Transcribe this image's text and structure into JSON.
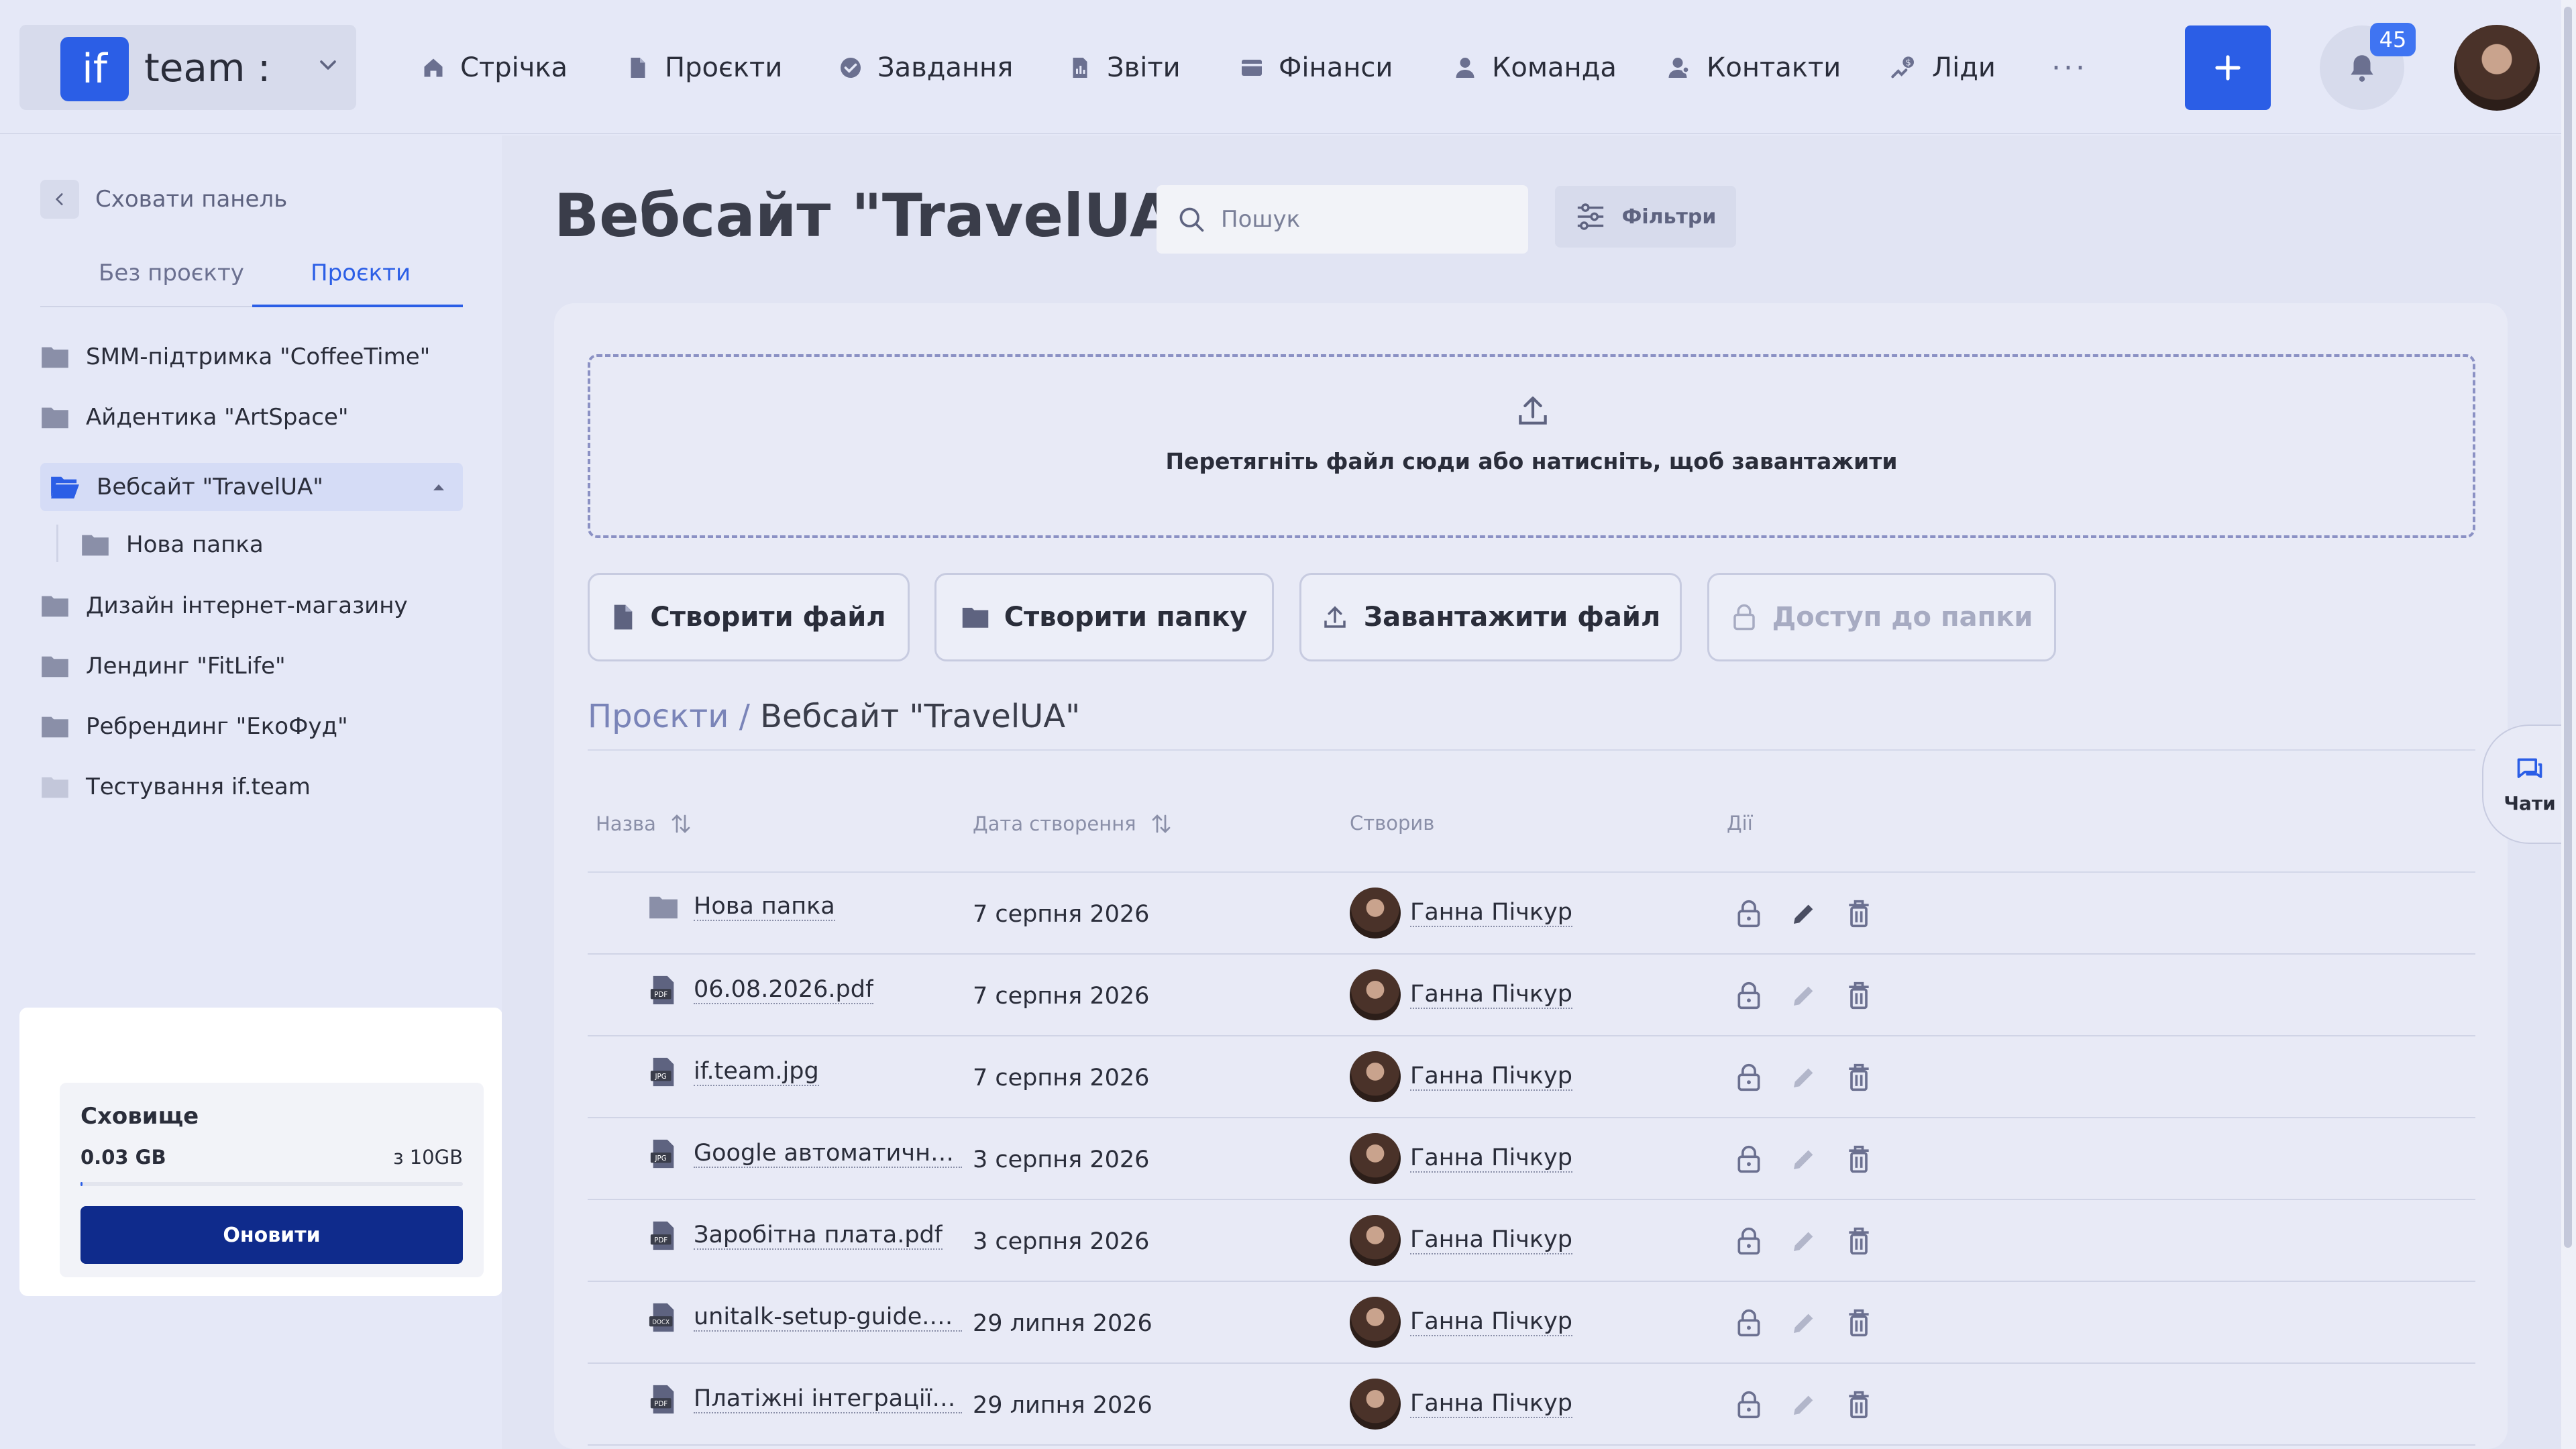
{
  "app": {
    "logo_text": "if",
    "team_name": "team :",
    "notifications_count": "45"
  },
  "nav": {
    "items": [
      {
        "label": "Стрічка",
        "icon": "home-icon"
      },
      {
        "label": "Проєкти",
        "icon": "document-icon"
      },
      {
        "label": "Завдання",
        "icon": "check-circle-icon"
      },
      {
        "label": "Звіти",
        "icon": "report-icon"
      },
      {
        "label": "Фінанси",
        "icon": "wallet-icon"
      },
      {
        "label": "Команда",
        "icon": "user-icon"
      },
      {
        "label": "Контакти",
        "icon": "contacts-icon"
      },
      {
        "label": "Ліди",
        "icon": "leads-icon"
      }
    ],
    "more_label": "···"
  },
  "sidebar": {
    "hide_label": "Сховати панель",
    "tabs": [
      {
        "label": "Без проєкту",
        "active": false
      },
      {
        "label": "Проєкти",
        "active": true
      }
    ],
    "projects": [
      {
        "label": "SMM-підтримка \"CoffeeTime\""
      },
      {
        "label": "Айдентика \"ArtSpace\""
      },
      {
        "label": "Вебсайт \"TravelUA\"",
        "active": true
      },
      {
        "label": "Нова папка",
        "sub": true
      },
      {
        "label": "Дизайн інтернет-магазину"
      },
      {
        "label": "Лендинг \"FitLife\""
      },
      {
        "label": "Ребрендинг \"ЕкоФуд\""
      },
      {
        "label": "Тестування if.team"
      }
    ]
  },
  "storage": {
    "title": "Сховище",
    "used": "0.03 GB",
    "total": "з 10GB",
    "fraction_used": 0.003,
    "button_label": "Оновити"
  },
  "main": {
    "title": "Вебсайт \"TravelUA\"",
    "search_placeholder": "Пошук",
    "filters_label": "Фільтри",
    "dropzone_text": "Перетягніть файл сюди або натисніть, щоб завантажити",
    "actions": [
      {
        "label": "Створити файл",
        "icon": "file-icon",
        "disabled": false
      },
      {
        "label": "Створити папку",
        "icon": "folder-icon",
        "disabled": false
      },
      {
        "label": "Завантажити файл",
        "icon": "upload-icon",
        "disabled": false
      },
      {
        "label": "Доступ до папки",
        "icon": "lock-icon",
        "disabled": true
      }
    ],
    "breadcrumb": {
      "root": "Проєкти",
      "separator": "/",
      "current": "Вебсайт \"TravelUA\""
    },
    "table": {
      "columns": [
        "Назва",
        "Дата створення",
        "Створив",
        "Дії"
      ],
      "rows": [
        {
          "name": "Нова папка",
          "type": "folder",
          "date": "7 серпня 2026",
          "author": "Ганна Пічкур"
        },
        {
          "name": "06.08.2026.pdf",
          "type": "pdf",
          "date": "7 серпня 2026",
          "author": "Ганна Пічкур"
        },
        {
          "name": "if.team.jpg",
          "type": "jpg",
          "date": "7 серпня 2026",
          "author": "Ганна Пічкур"
        },
        {
          "name": "Google автоматично в...",
          "type": "jpg",
          "date": "3 серпня 2026",
          "author": "Ганна Пічкур"
        },
        {
          "name": "Заробітна плата.pdf",
          "type": "pdf",
          "date": "3 серпня 2026",
          "author": "Ганна Пічкур"
        },
        {
          "name": "unitalk-setup-guide.d...",
          "type": "docx",
          "date": "29 липня 2026",
          "author": "Ганна Пічкур"
        },
        {
          "name": "Платіжні інтеграції.pdf",
          "type": "pdf",
          "date": "29 липня 2026",
          "author": "Ганна Пічкур"
        }
      ]
    }
  },
  "chats_label": "Чати",
  "colors": {
    "accent": "#2b5ee6",
    "dark_button": "#0f2b8c",
    "background": "#e5e8f7"
  }
}
